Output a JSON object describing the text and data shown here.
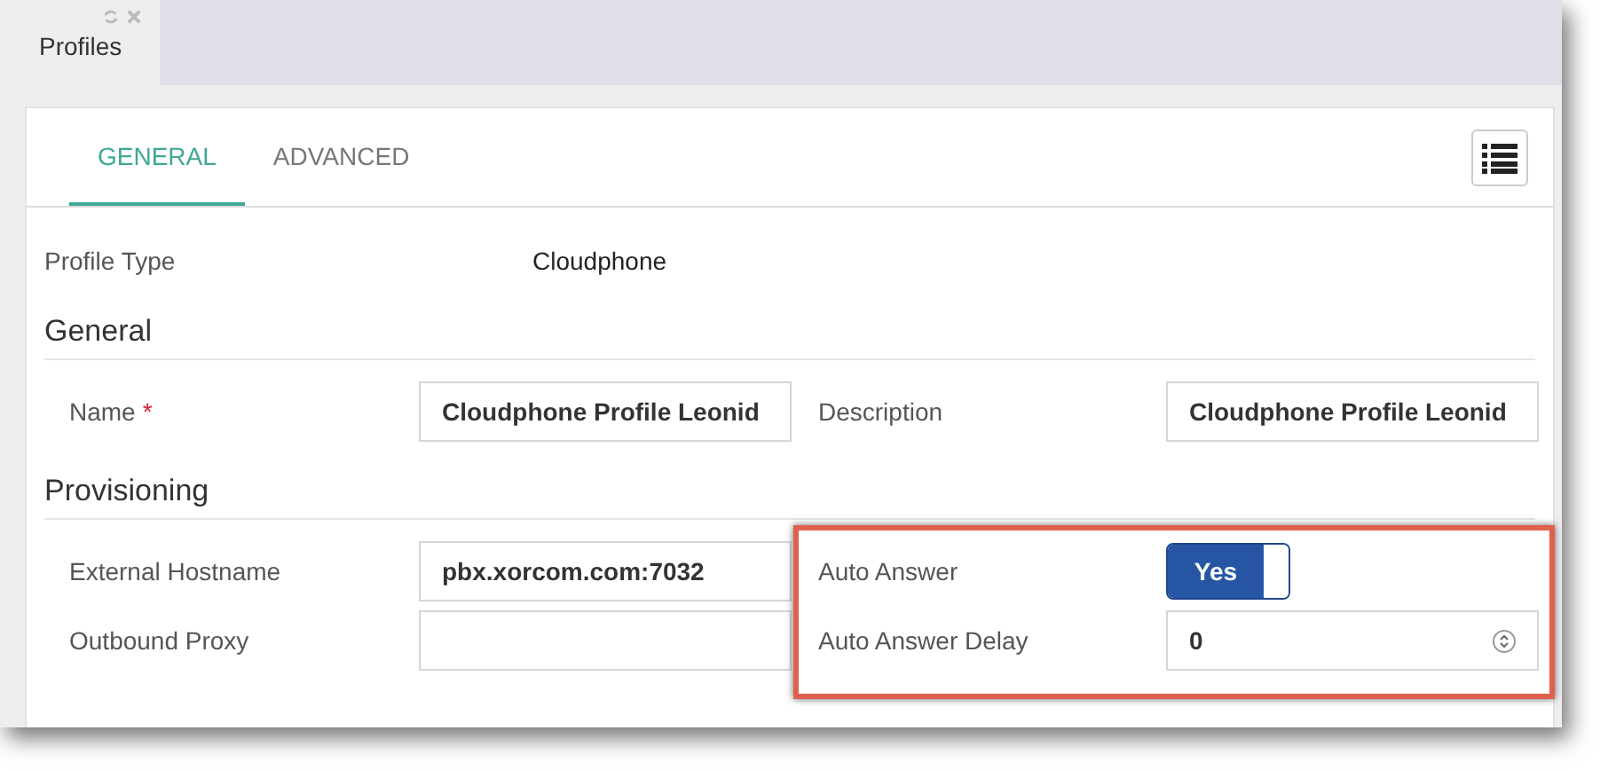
{
  "window_tabs": [
    {
      "label": "Profiles",
      "selected": true
    }
  ],
  "tabs": [
    {
      "label": "GENERAL",
      "selected": true
    },
    {
      "label": "ADVANCED",
      "selected": false
    }
  ],
  "profile_type": {
    "label": "Profile Type",
    "value": "Cloudphone"
  },
  "sections": [
    {
      "title": "General",
      "rows": [
        [
          {
            "kind": "text",
            "label": "Name",
            "required_mark": "*",
            "value": "Cloudphone Profile Leonid"
          },
          {
            "kind": "text",
            "label": "Description",
            "value": "Cloudphone Profile Leonid"
          }
        ]
      ]
    },
    {
      "title": "Provisioning",
      "rows": [
        [
          {
            "kind": "text",
            "label": "External Hostname",
            "value": "pbx.xorcom.com:7032"
          },
          {
            "kind": "toggle",
            "label": "Auto Answer",
            "on": true,
            "value": "Yes"
          }
        ],
        [
          {
            "kind": "text",
            "label": "Outbound Proxy"
          },
          {
            "kind": "number",
            "label": "Auto Answer Delay",
            "value": "0"
          }
        ]
      ]
    }
  ]
}
